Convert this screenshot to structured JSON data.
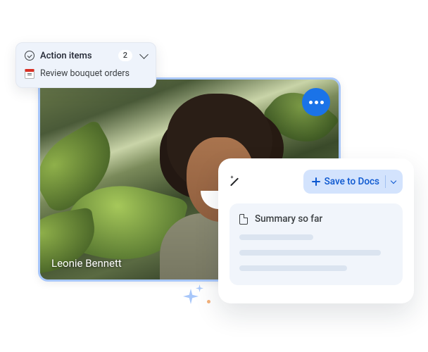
{
  "video": {
    "participant_name": "Leonie Bennett"
  },
  "action_panel": {
    "title": "Action items",
    "count": "2",
    "items": [
      {
        "label": "Review bouquet orders"
      }
    ]
  },
  "summary_card": {
    "save_label": "Save to Docs",
    "title": "Summary so far"
  }
}
